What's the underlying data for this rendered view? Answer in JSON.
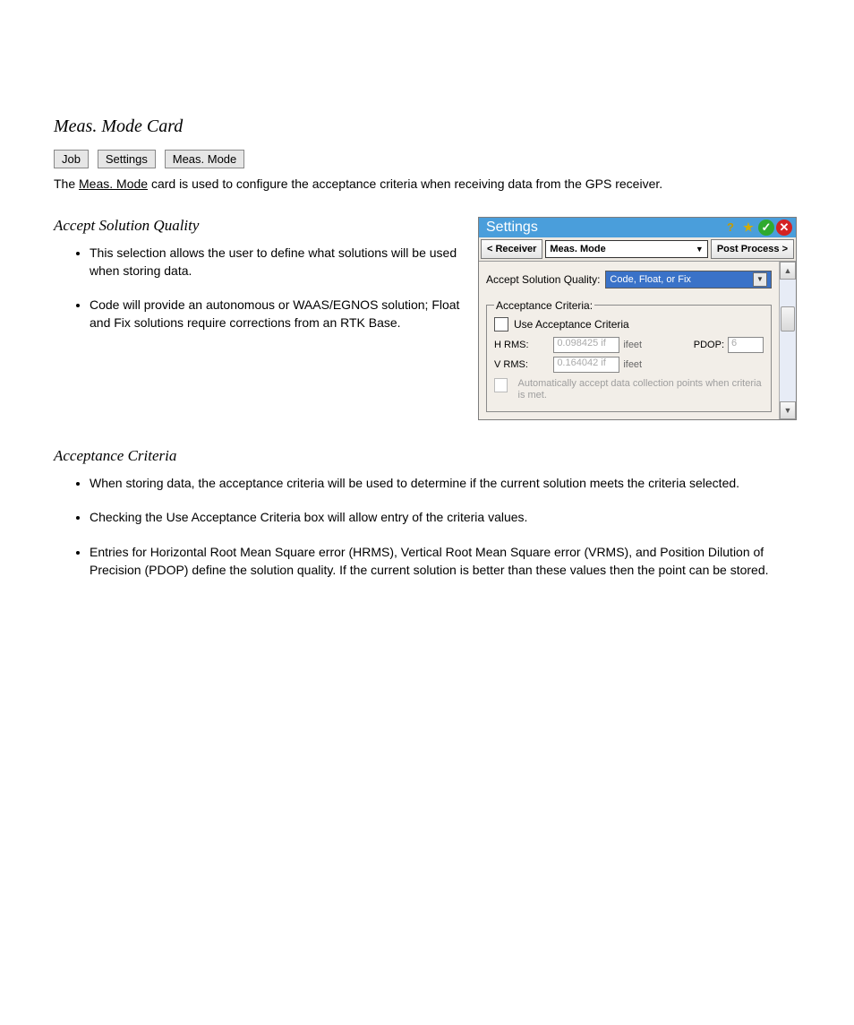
{
  "section_heading": "Meas. Mode Card",
  "breadcrumb": {
    "job": "Job",
    "settings": "Settings",
    "measmode": "Meas. Mode"
  },
  "intro_prefix": "The ",
  "intro_underlined": "Meas. Mode",
  "intro_suffix": " card is used to configure the acceptance criteria when receiving data from the GPS receiver.",
  "asq": {
    "field_label": "Accept Solution Quality",
    "bullets": [
      "This selection allows the user to define what solutions will be used when storing data.",
      "Code will provide an autonomous or WAAS/EGNOS solution; Float and Fix solutions require corrections from an RTK Base."
    ]
  },
  "ac": {
    "field_label": "Acceptance Criteria",
    "bullets": [
      "When storing data, the acceptance criteria will be used to determine if the current solution meets the criteria selected.",
      "Checking the Use Acceptance Criteria box will allow entry of the criteria values.",
      "Entries for Horizontal Root Mean Square error (HRMS), Vertical Root Mean Square error (VRMS), and Position Dilution of Precision (PDOP) define the solution quality. If the current solution is better than these values then the point can be stored."
    ]
  },
  "panel": {
    "title": "Settings",
    "tabs": {
      "prev": "< Receiver",
      "current": "Meas. Mode",
      "next": "Post Process >"
    },
    "accept_label": "Accept Solution Quality:",
    "accept_value": "Code, Float, or Fix",
    "criteria_legend": "Acceptance Criteria:",
    "use_criteria": "Use Acceptance Criteria",
    "hrms_label": "H RMS:",
    "hrms_value": "0.098425 if",
    "vrms_label": "V RMS:",
    "vrms_value": "0.164042 if",
    "unit": "ifeet",
    "pdop_label": "PDOP:",
    "pdop_value": "6",
    "auto_accept": "Automatically accept data collection points when criteria is met."
  }
}
